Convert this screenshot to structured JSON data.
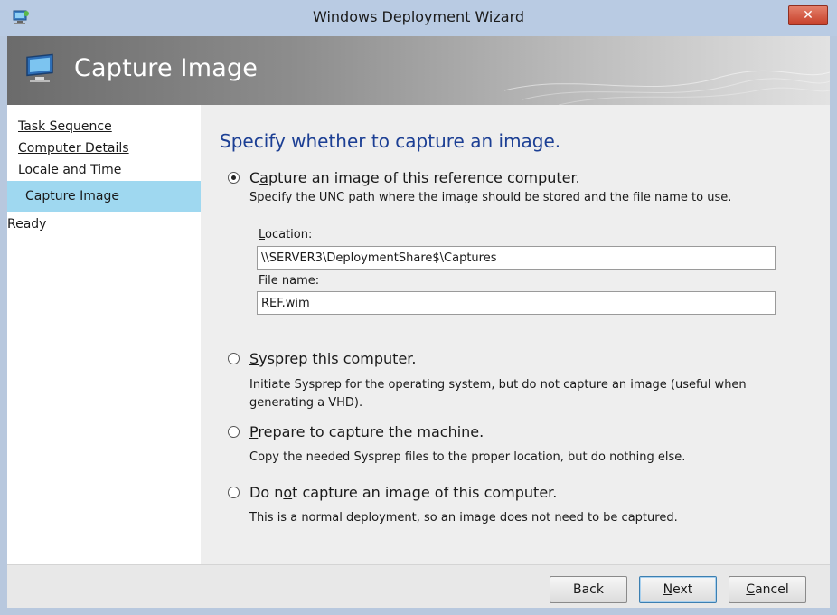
{
  "window": {
    "title": "Windows Deployment Wizard",
    "close_glyph": "✕",
    "app_icon": "wizard-app-icon"
  },
  "header": {
    "title": "Capture Image",
    "icon": "computer-monitor-icon"
  },
  "nav": {
    "items": [
      {
        "label": "Task Sequence",
        "state": "completed"
      },
      {
        "label": "Computer Details",
        "state": "completed"
      },
      {
        "label": "Locale and Time",
        "state": "completed"
      },
      {
        "label": "Capture Image",
        "state": "current"
      },
      {
        "label": "Ready",
        "state": "pending"
      }
    ]
  },
  "main": {
    "heading": "Specify whether to capture an image.",
    "options": [
      {
        "label_pre": "C",
        "label_key": "a",
        "label_post": "pture an image of this reference computer.",
        "description": "Specify the UNC path where the image should be stored and the file name to use.",
        "checked": true
      },
      {
        "label_pre": "",
        "label_key": "S",
        "label_post": "ysprep this computer.",
        "description": "Initiate Sysprep for the operating system, but do not capture an image (useful when generating a VHD).",
        "checked": false
      },
      {
        "label_pre": "",
        "label_key": "P",
        "label_post": "repare to capture the machine.",
        "description": "Copy the needed Sysprep files to the proper location, but do nothing else.",
        "checked": false
      },
      {
        "label_pre": "Do n",
        "label_key": "o",
        "label_post": "t capture an image of this computer.",
        "description": "This is a normal deployment, so an image does not need to be captured.",
        "checked": false
      }
    ],
    "location": {
      "label_key": "L",
      "label_rest": "ocation:",
      "value": "\\\\SERVER3\\DeploymentShare$\\Captures"
    },
    "file_name": {
      "label": "File name:",
      "value": "REF.wim"
    }
  },
  "footer": {
    "back_label": "Back",
    "next_key": "N",
    "next_rest": "ext",
    "cancel_key": "C",
    "cancel_rest": "ancel"
  },
  "colors": {
    "accent_heading": "#1c3f94",
    "nav_selected": "#9fd8f0",
    "close_button": "#c7402a"
  }
}
